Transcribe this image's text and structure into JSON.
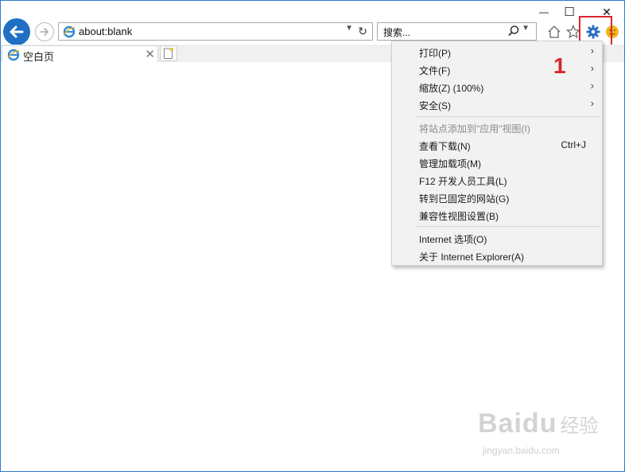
{
  "caption": {
    "minimize": "—",
    "maximize": "☐",
    "close": "✕"
  },
  "address_bar": {
    "url": "about:blank"
  },
  "search_box": {
    "placeholder": "搜索..."
  },
  "tabs": [
    {
      "title": "空白页",
      "close": "✕"
    }
  ],
  "menu": {
    "items": [
      {
        "label": "打印(P)",
        "arrow": "›"
      },
      {
        "label": "文件(F)",
        "arrow": "›"
      },
      {
        "label": "缩放(Z) (100%)",
        "arrow": "›"
      },
      {
        "label": "安全(S)",
        "arrow": "›"
      },
      {
        "label": "将站点添加到\"应用\"视图(I)",
        "disabled": true
      },
      {
        "label": "查看下载(N)",
        "shortcut": "Ctrl+J"
      },
      {
        "label": "管理加载项(M)"
      },
      {
        "label": "F12 开发人员工具(L)"
      },
      {
        "label": "转到已固定的网站(G)"
      },
      {
        "label": "兼容性视图设置(B)"
      },
      {
        "label": "Internet 选项(O)"
      },
      {
        "label": "关于 Internet Explorer(A)"
      }
    ]
  },
  "annotation": {
    "step_number": "1",
    "highlight_color": "#d9262c"
  },
  "watermark": {
    "logo": "Bai",
    "logo2": "du",
    "cn": "经验",
    "site": "jingyan.baidu.com"
  },
  "colors": {
    "accent": "#1f6fc5",
    "menu_bg": "#f2f2f2",
    "window_border": "#2b7bd0"
  }
}
